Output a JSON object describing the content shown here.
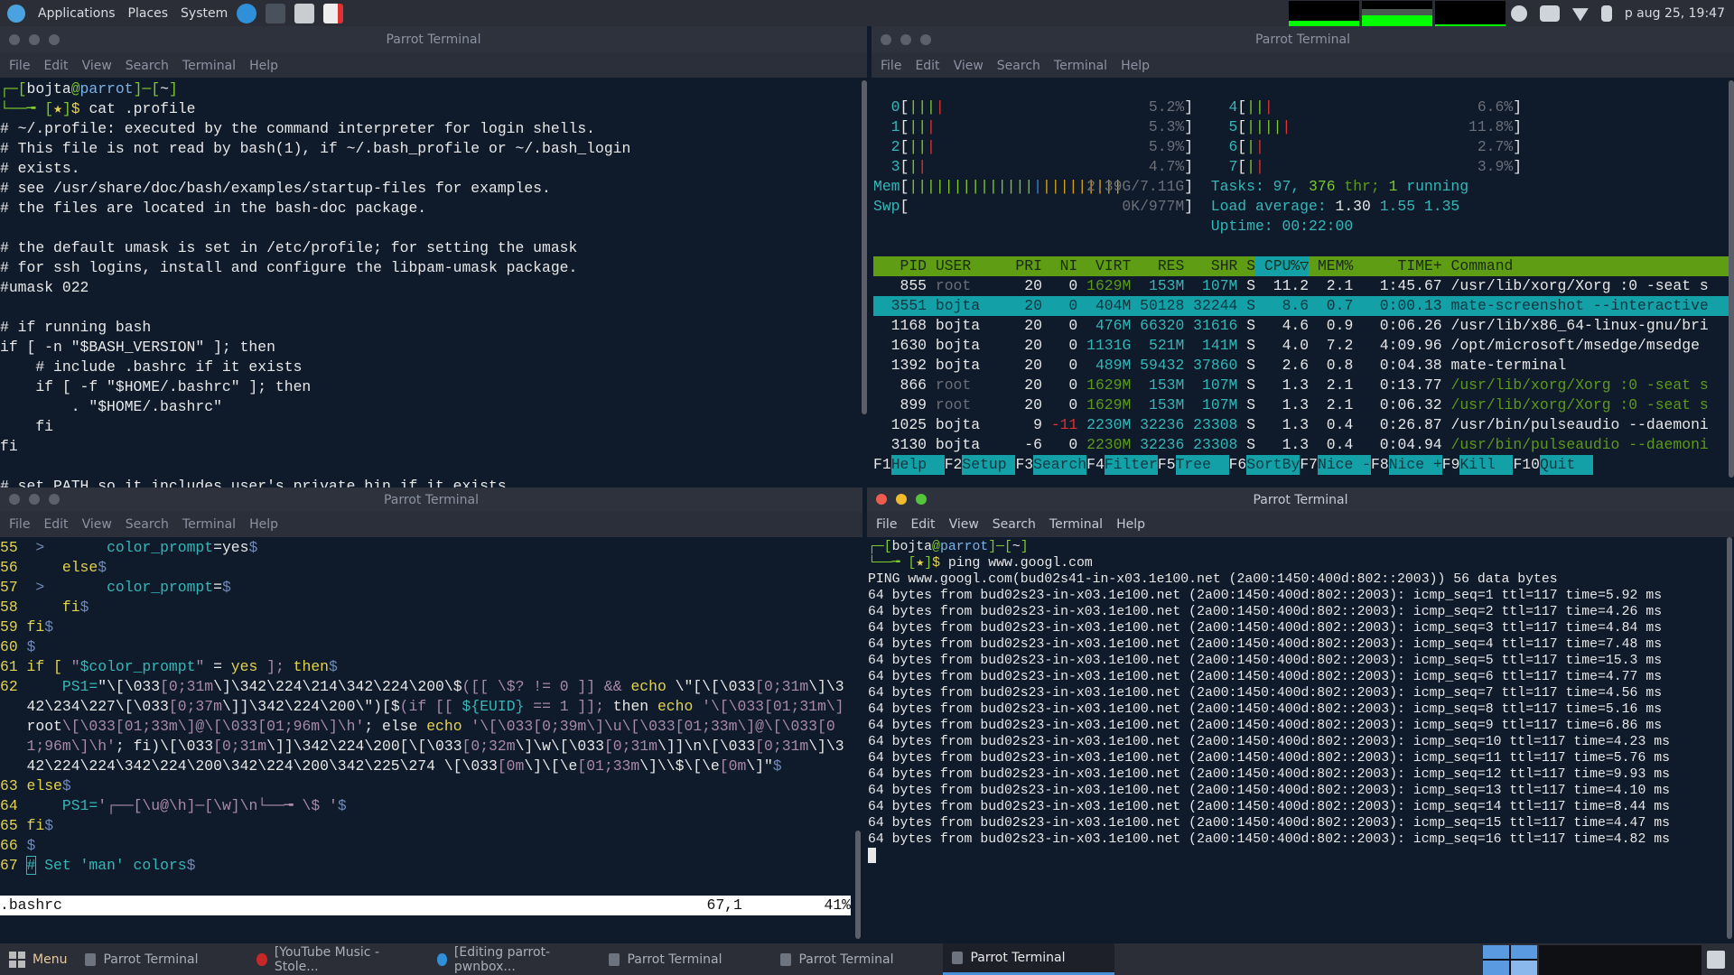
{
  "top_panel": {
    "menus": [
      "Applications",
      "Places",
      "System"
    ],
    "launchers": [
      "edge-icon",
      "terminal-icon",
      "file-manager-icon",
      "text-editor-icon"
    ],
    "clock": "p aug 25, 19:47",
    "tray": [
      "bluetooth-icon",
      "volume-icon",
      "wifi-icon",
      "battery-icon"
    ]
  },
  "windows": {
    "profile": {
      "title": "Parrot Terminal",
      "menu": [
        "File",
        "Edit",
        "View",
        "Search",
        "Terminal",
        "Help"
      ],
      "lines": [
        [
          [
            "┌─[",
            "g"
          ],
          [
            "bojta",
            "w"
          ],
          [
            "@",
            "g"
          ],
          [
            "parrot",
            "bc"
          ],
          [
            "]─[",
            "g"
          ],
          [
            "~",
            "w"
          ],
          [
            "]",
            "g"
          ]
        ],
        [
          [
            "└──╼ ",
            "g"
          ],
          [
            "[",
            "g"
          ],
          [
            "★",
            "y"
          ],
          [
            "]",
            "g"
          ],
          [
            "$ ",
            "y"
          ],
          [
            "cat .profile",
            "w"
          ]
        ],
        [
          [
            "# ~/.profile: executed by the command interpreter for login shells.",
            "w"
          ]
        ],
        [
          [
            "# This file is not read by bash(1), if ~/.bash_profile or ~/.bash_login",
            "w"
          ]
        ],
        [
          [
            "# exists.",
            "w"
          ]
        ],
        [
          [
            "# see /usr/share/doc/bash/examples/startup-files for examples.",
            "w"
          ]
        ],
        [
          [
            "# the files are located in the bash-doc package.",
            "w"
          ]
        ],
        [
          [
            "",
            "w"
          ]
        ],
        [
          [
            "# the default umask is set in /etc/profile; for setting the umask",
            "w"
          ]
        ],
        [
          [
            "# for ssh logins, install and configure the libpam-umask package.",
            "w"
          ]
        ],
        [
          [
            "#umask 022",
            "w"
          ]
        ],
        [
          [
            "",
            "w"
          ]
        ],
        [
          [
            "# if running bash",
            "w"
          ]
        ],
        [
          [
            "if [ -n \"$BASH_VERSION\" ]; then",
            "w"
          ]
        ],
        [
          [
            "    # include .bashrc if it exists",
            "w"
          ]
        ],
        [
          [
            "    if [ -f \"$HOME/.bashrc\" ]; then",
            "w"
          ]
        ],
        [
          [
            "        . \"$HOME/.bashrc\"",
            "w"
          ]
        ],
        [
          [
            "    fi",
            "w"
          ]
        ],
        [
          [
            "fi",
            "w"
          ]
        ],
        [
          [
            "",
            "w"
          ]
        ],
        [
          [
            "# set PATH so it includes user's private bin if it exists",
            "w"
          ]
        ]
      ]
    },
    "htop": {
      "title": "Parrot Terminal",
      "menu": [
        "File",
        "Edit",
        "View",
        "Search",
        "Terminal",
        "Help"
      ],
      "cpus": [
        {
          "id": "0",
          "pct": "5.2%",
          "bars": "gggr"
        },
        {
          "id": "1",
          "pct": "5.3%",
          "bars": "ggr"
        },
        {
          "id": "2",
          "pct": "5.9%",
          "bars": "ggr"
        },
        {
          "id": "3",
          "pct": "4.7%",
          "bars": "gr"
        },
        {
          "id": "4",
          "pct": "6.6%",
          "bars": "ggr"
        },
        {
          "id": "5",
          "pct": "11.8%",
          "bars": "ggggr"
        },
        {
          "id": "6",
          "pct": "2.7%",
          "bars": "gr"
        },
        {
          "id": "7",
          "pct": "3.9%",
          "bars": "gr"
        }
      ],
      "mem": {
        "label": "Mem",
        "value": "2.39G/7.11G",
        "bars": "ggggggggggggggbooooooooo"
      },
      "swp": {
        "label": "Swp",
        "value": "0K/977M"
      },
      "tasks": {
        "label": "Tasks: ",
        "count": "97",
        "sep": ", ",
        "thr": "376",
        "thr_label": " thr; ",
        "running": "1",
        "running_label": " running"
      },
      "load": {
        "label": "Load average: ",
        "v1": "1.30",
        "v5": "1.55",
        "v15": "1.35"
      },
      "uptime": {
        "label": "Uptime: ",
        "value": "00:22:00"
      },
      "columns": [
        "PID",
        "USER",
        "PRI",
        "NI",
        "VIRT",
        "RES",
        "SHR",
        "S",
        "CPU%▽",
        "MEM%",
        "TIME+",
        "Command"
      ],
      "processes": [
        {
          "pid": "855",
          "user": "root",
          "pri": "20",
          "ni": "0",
          "virt": "1629M",
          "res": "153M",
          "shr": "107M",
          "s": "S",
          "cpu": "11.2",
          "mem": "2.1",
          "time": "1:45.67",
          "cmd": "/usr/lib/xorg/Xorg :0 -seat s",
          "kind": "root"
        },
        {
          "pid": "3551",
          "user": "bojta",
          "pri": "20",
          "ni": "0",
          "virt": "404M",
          "res": "50128",
          "shr": "32244",
          "s": "S",
          "cpu": "8.6",
          "mem": "0.7",
          "time": "0:00.13",
          "cmd": "mate-screenshot --interactive",
          "kind": "selected"
        },
        {
          "pid": "1168",
          "user": "bojta",
          "pri": "20",
          "ni": "0",
          "virt": "476M",
          "res": "66320",
          "shr": "31616",
          "s": "S",
          "cpu": "4.6",
          "mem": "0.9",
          "time": "0:06.26",
          "cmd": "/usr/lib/x86_64-linux-gnu/bri",
          "kind": "user"
        },
        {
          "pid": "1630",
          "user": "bojta",
          "pri": "20",
          "ni": "0",
          "virt": "1131G",
          "res": "521M",
          "shr": "141M",
          "s": "S",
          "cpu": "4.0",
          "mem": "7.2",
          "time": "4:09.96",
          "cmd": "/opt/microsoft/msedge/msedge",
          "kind": "user"
        },
        {
          "pid": "1392",
          "user": "bojta",
          "pri": "20",
          "ni": "0",
          "virt": "489M",
          "res": "59432",
          "shr": "37860",
          "s": "S",
          "cpu": "2.6",
          "mem": "0.8",
          "time": "0:04.38",
          "cmd": "mate-terminal",
          "kind": "user"
        },
        {
          "pid": "866",
          "user": "root",
          "pri": "20",
          "ni": "0",
          "virt": "1629M",
          "res": "153M",
          "shr": "107M",
          "s": "S",
          "cpu": "1.3",
          "mem": "2.1",
          "time": "0:13.77",
          "cmd": "/usr/lib/xorg/Xorg :0 -seat s",
          "kind": "root-thread"
        },
        {
          "pid": "899",
          "user": "root",
          "pri": "20",
          "ni": "0",
          "virt": "1629M",
          "res": "153M",
          "shr": "107M",
          "s": "S",
          "cpu": "1.3",
          "mem": "2.1",
          "time": "0:06.32",
          "cmd": "/usr/lib/xorg/Xorg :0 -seat s",
          "kind": "root-thread"
        },
        {
          "pid": "1025",
          "user": "bojta",
          "pri": "9",
          "ni": "-11",
          "virt": "2230M",
          "res": "32236",
          "shr": "23308",
          "s": "S",
          "cpu": "1.3",
          "mem": "0.4",
          "time": "0:26.87",
          "cmd": "/usr/bin/pulseaudio --daemoni",
          "kind": "user"
        },
        {
          "pid": "3130",
          "user": "bojta",
          "pri": "-6",
          "ni": "0",
          "virt": "2230M",
          "res": "32236",
          "shr": "23308",
          "s": "S",
          "cpu": "1.3",
          "mem": "0.4",
          "time": "0:04.94",
          "cmd": "/usr/bin/pulseaudio --daemoni",
          "kind": "thread"
        }
      ],
      "fkeys": [
        [
          "F1",
          "Help  "
        ],
        [
          "F2",
          "Setup "
        ],
        [
          "F3",
          "Search"
        ],
        [
          "F4",
          "Filter"
        ],
        [
          "F5",
          "Tree  "
        ],
        [
          "F6",
          "SortBy"
        ],
        [
          "F7",
          "Nice -"
        ],
        [
          "F8",
          "Nice +"
        ],
        [
          "F9",
          "Kill  "
        ],
        [
          "F10",
          "Quit  "
        ]
      ]
    },
    "vim": {
      "title": "Parrot Terminal",
      "menu": [
        "File",
        "Edit",
        "View",
        "Search",
        "Terminal",
        "Help"
      ],
      "lines": [
        {
          "n": "55",
          "segs": [
            [
              " >       ",
              "b"
            ],
            [
              "color_prompt",
              "cy"
            ],
            [
              "=yes",
              "w"
            ],
            [
              "$",
              "b"
            ]
          ]
        },
        {
          "n": "56",
          "segs": [
            [
              "    ",
              "w"
            ],
            [
              "else",
              "y"
            ],
            [
              "$",
              "b"
            ]
          ]
        },
        {
          "n": "57",
          "segs": [
            [
              " >       ",
              "b"
            ],
            [
              "color_prompt",
              "cy"
            ],
            [
              "=",
              "w"
            ],
            [
              "$",
              "b"
            ]
          ]
        },
        {
          "n": "58",
          "segs": [
            [
              "    ",
              "w"
            ],
            [
              "fi",
              "y"
            ],
            [
              "$",
              "b"
            ]
          ]
        },
        {
          "n": "59",
          "segs": [
            [
              "fi",
              "y"
            ],
            [
              "$",
              "b"
            ]
          ]
        },
        {
          "n": "60",
          "segs": [
            [
              "$",
              "b"
            ]
          ]
        },
        {
          "n": "61",
          "segs": [
            [
              "if",
              "y"
            ],
            [
              " [ ",
              "y"
            ],
            [
              "\"",
              "p"
            ],
            [
              "$color_prompt",
              "cy"
            ],
            [
              "\"",
              "p"
            ],
            [
              " = ",
              "w"
            ],
            [
              "yes",
              "y"
            ],
            [
              " ]; ",
              "p"
            ],
            [
              "then",
              "y"
            ],
            [
              "$",
              "b"
            ]
          ]
        },
        {
          "n": "62",
          "segs": [
            [
              "    PS1=",
              "cy"
            ],
            [
              "\"\\[\\033",
              "w"
            ],
            [
              "[0;31m",
              "p"
            ],
            [
              "\\]\\342\\224\\214\\342\\224\\200\\$",
              "w"
            ],
            [
              "([[ \\$? != 0 ]] && ",
              "p"
            ],
            [
              "echo ",
              "y"
            ],
            [
              "\\\"[\\[\\033",
              "w"
            ],
            [
              "[0;31m",
              "p"
            ],
            [
              "\\]\\342\\234\\227\\[\\033",
              "w"
            ],
            [
              "[0;37m",
              "p"
            ],
            [
              "\\]]\\342\\224\\200\\\")[$",
              "w"
            ],
            [
              "(if [[ ",
              "p"
            ],
            [
              "${EUID}",
              "cy"
            ],
            [
              " == 1 ]]; ",
              "p"
            ],
            [
              "then ",
              "w"
            ],
            [
              "echo ",
              "y"
            ],
            [
              "'\\[\\033[01;31m\\]",
              "p"
            ],
            [
              "root",
              "w"
            ],
            [
              "\\[\\033[01;33m\\]@\\[\\033[01;96m\\]\\h'",
              "p"
            ],
            [
              "; ",
              "w"
            ],
            [
              "else ",
              "w"
            ],
            [
              "echo ",
              "y"
            ],
            [
              "'\\[\\033[0;39m\\]\\u\\[\\033[01;33m\\]@\\[\\033[01;96m\\]\\h'",
              "p"
            ],
            [
              "; fi)",
              "w"
            ],
            [
              "\\[\\033",
              "w"
            ],
            [
              "[0;31m",
              "p"
            ],
            [
              "\\]]\\342\\224\\200[\\[\\033",
              "w"
            ],
            [
              "[0;32m",
              "p"
            ],
            [
              "\\]\\w\\[\\033",
              "w"
            ],
            [
              "[0;31m",
              "p"
            ],
            [
              "\\]]\\n\\[\\033",
              "w"
            ],
            [
              "[0;31m",
              "p"
            ],
            [
              "\\]\\342\\224\\224\\342\\224\\200\\342\\224\\200\\342\\225\\274 \\[\\033",
              "w"
            ],
            [
              "[0m",
              "p"
            ],
            [
              "\\]\\[\\e",
              "w"
            ],
            [
              "[01;33m",
              "p"
            ],
            [
              "\\]\\\\$\\[\\e",
              "w"
            ],
            [
              "[0m",
              "p"
            ],
            [
              "\\]\"",
              "w"
            ],
            [
              "$",
              "b"
            ]
          ]
        },
        {
          "n": "63",
          "segs": [
            [
              "else",
              "y"
            ],
            [
              "$",
              "b"
            ]
          ]
        },
        {
          "n": "64",
          "segs": [
            [
              "    PS1=",
              "cy"
            ],
            [
              "'┌──[\\u@\\h]─[\\w]\\n└──╼ \\$ '",
              "p"
            ],
            [
              "$",
              "b"
            ]
          ]
        },
        {
          "n": "65",
          "segs": [
            [
              "fi",
              "y"
            ],
            [
              "$",
              "b"
            ]
          ]
        },
        {
          "n": "66",
          "segs": [
            [
              "$",
              "b"
            ]
          ]
        },
        {
          "n": "67",
          "segs": [
            [
              "#",
              "cy"
            ],
            [
              " Set 'man' colors",
              "cy"
            ],
            [
              "$",
              "b"
            ]
          ]
        }
      ],
      "status": {
        "file": ".bashrc",
        "pos": "67,1",
        "percent": "41%"
      }
    },
    "ping": {
      "title": "Parrot Terminal",
      "menu": [
        "File",
        "Edit",
        "View",
        "Search",
        "Terminal",
        "Help"
      ],
      "prompt_user": "bojta",
      "prompt_host": "parrot",
      "prompt_dir": "~",
      "command": "ping www.googl.com",
      "header": "PING www.googl.com(bud02s41-in-x03.1e100.net (2a00:1450:400d:802::2003)) 56 data bytes",
      "replies": [
        {
          "seq": "1",
          "time": "5.92"
        },
        {
          "seq": "2",
          "time": "4.26"
        },
        {
          "seq": "3",
          "time": "4.84"
        },
        {
          "seq": "4",
          "time": "7.48"
        },
        {
          "seq": "5",
          "time": "15.3"
        },
        {
          "seq": "6",
          "time": "4.77"
        },
        {
          "seq": "7",
          "time": "4.56"
        },
        {
          "seq": "8",
          "time": "5.16"
        },
        {
          "seq": "9",
          "time": "6.86"
        },
        {
          "seq": "10",
          "time": "4.23"
        },
        {
          "seq": "11",
          "time": "5.76"
        },
        {
          "seq": "12",
          "time": "9.93"
        },
        {
          "seq": "13",
          "time": "4.10"
        },
        {
          "seq": "14",
          "time": "8.44"
        },
        {
          "seq": "15",
          "time": "4.47"
        },
        {
          "seq": "16",
          "time": "4.82"
        }
      ],
      "reply_prefix": "64 bytes from bud02s23-in-x03.1e100.net (2a00:1450:400d:802::2003): icmp_seq=",
      "reply_ttl": " ttl=117 time=",
      "reply_unit": " ms"
    }
  },
  "taskbar": {
    "menu": "Menu",
    "items": [
      {
        "label": "Parrot Terminal",
        "icon": "terminal-icon",
        "active": false
      },
      {
        "label": "[YouTube Music - Stole...",
        "icon": "youtube-music-icon",
        "active": false
      },
      {
        "label": "[Editing parrot-pwnbox...",
        "icon": "edge-icon",
        "active": false
      },
      {
        "label": "Parrot Terminal",
        "icon": "terminal-icon",
        "active": false
      },
      {
        "label": "Parrot Terminal",
        "icon": "terminal-icon",
        "active": false
      },
      {
        "label": "Parrot Terminal",
        "icon": "terminal-icon",
        "active": true
      }
    ]
  }
}
